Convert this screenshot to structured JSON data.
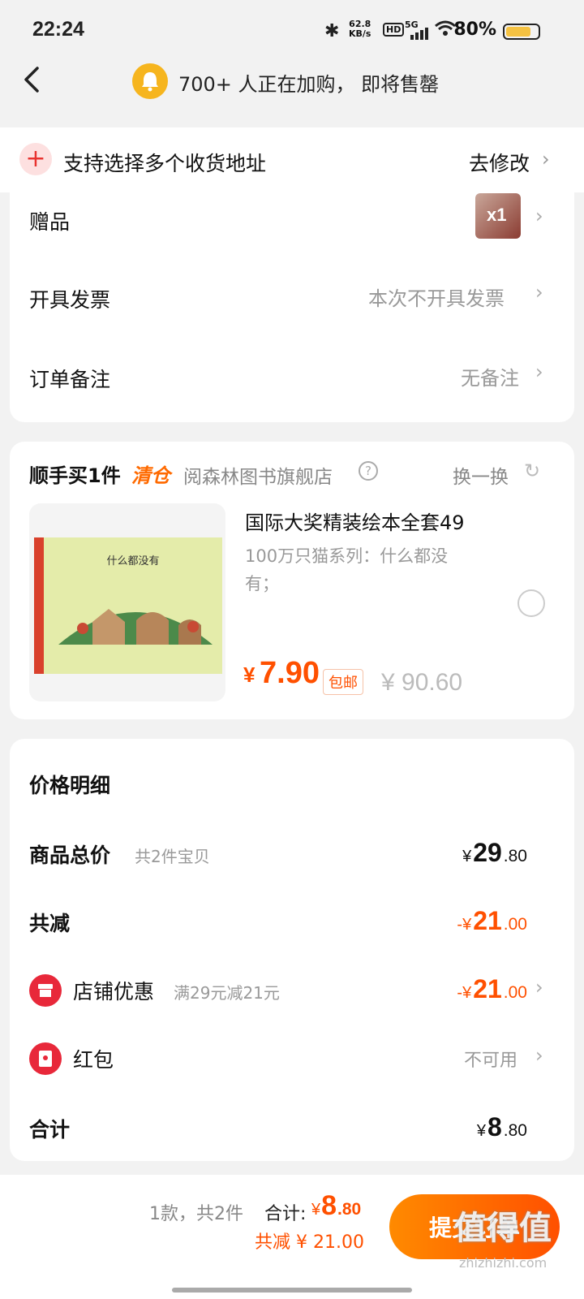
{
  "status_bar": {
    "time": "22:24",
    "net_speed": "62.8",
    "net_unit": "KB/s",
    "hd": "HD",
    "signal": "5G",
    "battery": "80%"
  },
  "header": {
    "headline": "700+ 人正在加购，  即将售罄"
  },
  "address": {
    "label": "支持选择多个收货地址",
    "action": "去修改"
  },
  "order_info": {
    "gift_label": "赠品",
    "gift_qty": "x1",
    "invoice_label": "开具发票",
    "invoice_value": "本次不开具发票",
    "note_label": "订单备注",
    "note_value": "无备注"
  },
  "upsell": {
    "title": "顺手买1件",
    "tag": "清仓",
    "store": "阅森林图书旗舰店",
    "refresh": "换一换",
    "product_title": "国际大奖精装绘本全套49",
    "product_sub": "100万只猫系列：什么都没有；",
    "book_cover_title": "什么都没有",
    "price_symbol": "¥",
    "price": "7.90",
    "shipping_badge": "包邮",
    "original_price": "¥ 90.60"
  },
  "price_detail": {
    "title": "价格明细",
    "goods_label": "商品总价",
    "goods_count": "共2件宝贝",
    "goods_yen": "¥",
    "goods_int": "29",
    "goods_dec": ".80",
    "reduce_label": "共减",
    "reduce_prefix": "-¥",
    "reduce_int": "21",
    "reduce_dec": ".00",
    "store_label": "店铺优惠",
    "store_rule": "满29元减21元",
    "store_prefix": "-¥",
    "store_int": "21",
    "store_dec": ".00",
    "redpack_label": "红包",
    "redpack_value": "不可用",
    "total_label": "合计",
    "total_yen": "¥",
    "total_int": "8",
    "total_dec": ".80"
  },
  "bottom_bar": {
    "count_text": "1款，共2件",
    "total_label": "合计:",
    "total_yen": "¥",
    "total_int": "8",
    "total_dec": ".80",
    "saved_text": "共减 ¥ 21.00",
    "submit_label": "提交订单"
  },
  "watermark": {
    "text": "值得值",
    "url": "zhizhizhi.com"
  }
}
